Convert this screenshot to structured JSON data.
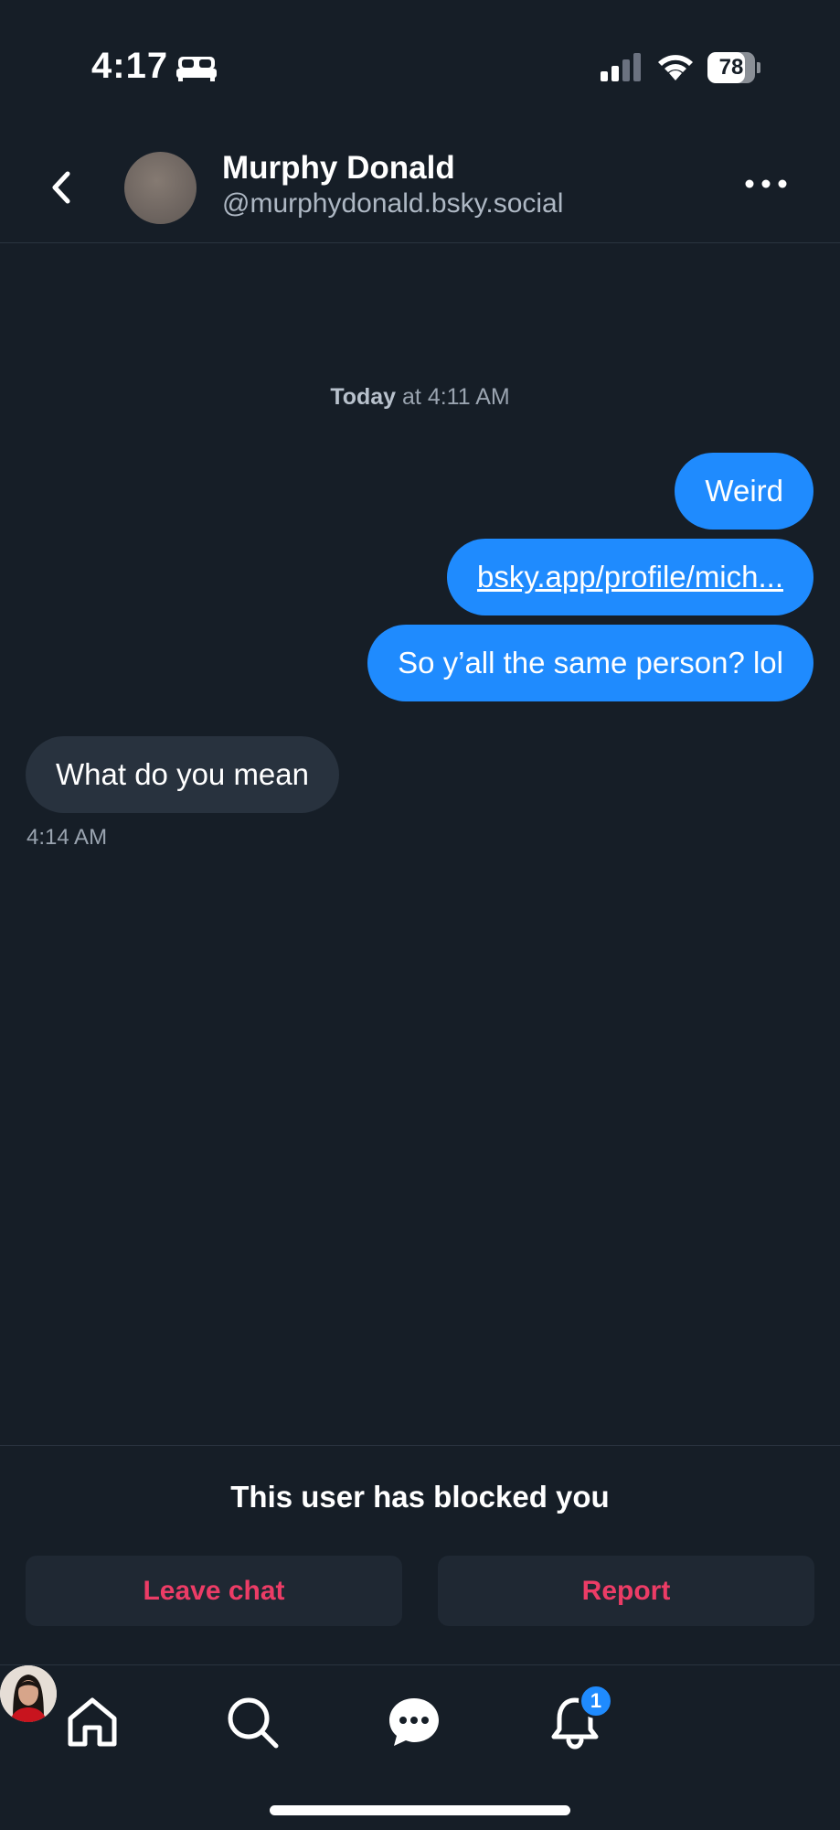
{
  "status_bar": {
    "time": "4:17",
    "battery_percent": "78",
    "battery_level": 0.78
  },
  "header": {
    "name": "Murphy Donald",
    "handle": "@murphydonald.bsky.social"
  },
  "conversation": {
    "day_label_bold": "Today",
    "day_label_rest": " at 4:11 AM",
    "messages": [
      {
        "from": "me",
        "text": "Weird"
      },
      {
        "from": "me",
        "text": "bsky.app/profile/mich..."
      },
      {
        "from": "me",
        "text": "So y’all the same person? lol"
      },
      {
        "from": "them",
        "text": "What do you mean",
        "time": "4:14 AM"
      }
    ]
  },
  "blocked_panel": {
    "message": "This user has blocked you",
    "leave_label": "Leave chat",
    "report_label": "Report"
  },
  "nav": {
    "notification_count": "1",
    "items": [
      "home-icon",
      "search-icon",
      "chat-icon",
      "bell-icon",
      "profile-avatar"
    ]
  },
  "colors": {
    "background": "#161e27",
    "accent": "#1f8bfe",
    "incoming_bubble": "#28323e",
    "danger": "#ec3c66"
  }
}
